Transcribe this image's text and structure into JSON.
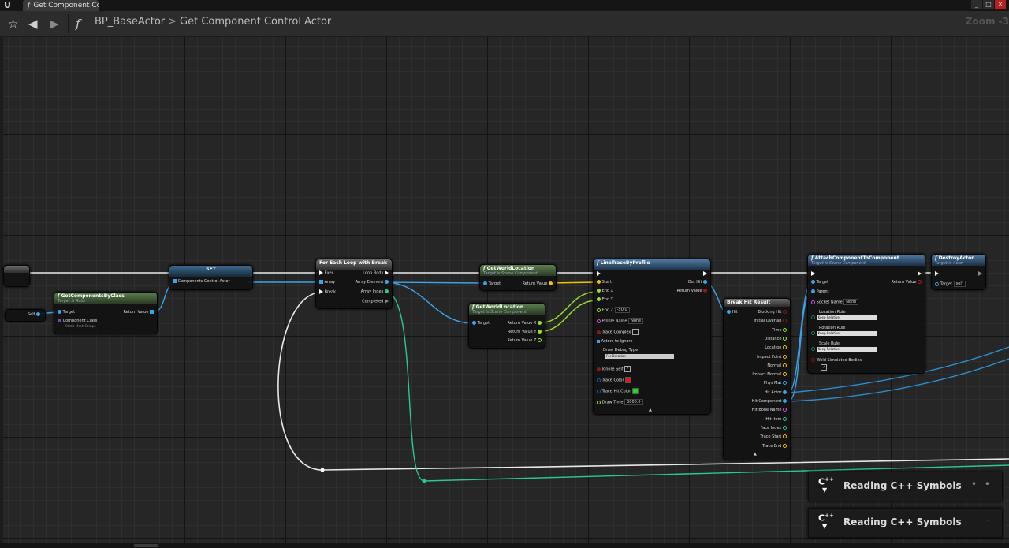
{
  "window": {
    "tab_title": "Get Component Cc",
    "tab_icon": "function-icon"
  },
  "toolbar": {
    "breadcrumb_root": "BP_BaseActor",
    "breadcrumb_separator": ">",
    "breadcrumb_current": "Get Component Control Actor",
    "zoom_label": "Zoom -3"
  },
  "nodes": {
    "get_components": {
      "title": "GetComponentsByClass",
      "subtitle": "Target is Actor",
      "target": "Target",
      "return_value": "Return Value",
      "component_class": "Component Class",
      "class_value": "Static Mesh Compo"
    },
    "self": {
      "label": "Self"
    },
    "set": {
      "title": "SET",
      "var": "Components Control Actor"
    },
    "foreach": {
      "title": "For Each Loop with Break",
      "exec": "Exec",
      "array": "Array",
      "break": "Break",
      "loop_body": "Loop Body",
      "array_element": "Array Element",
      "array_index": "Array Index",
      "completed": "Completed"
    },
    "getworld1": {
      "title": "GetWorldLocation",
      "subtitle": "Target is Scene Component",
      "target": "Target",
      "return_value": "Return Value"
    },
    "getworld2": {
      "title": "GetWorldLocation",
      "subtitle": "Target is Scene Component",
      "target": "Target",
      "rx": "Return Value X",
      "ry": "Return Value Y",
      "rz": "Return Value Z"
    },
    "linetrace": {
      "title": "LineTraceByProfile",
      "start": "Start",
      "end_x": "End X",
      "end_y": "End Y",
      "end_z": "End Z",
      "end_z_value": "-50.0",
      "profile_name": "Profile Name",
      "profile_value": "None",
      "trace_complex": "Trace Complex",
      "actors_to_ignore": "Actors to Ignore",
      "draw_debug_type": "Draw Debug Type",
      "draw_debug_value": "For Duration",
      "ignore_self": "Ignore Self",
      "trace_color": "Trace Color",
      "trace_hit_color": "Trace Hit Color",
      "draw_time": "Draw Time",
      "draw_time_value": "5000.0",
      "out_hit": "Out Hit",
      "return_value": "Return Value",
      "trace_color_hex": "#e01818",
      "trace_hit_color_hex": "#18e018"
    },
    "breakhit": {
      "title": "Break Hit Result",
      "hit": "Hit",
      "outputs": [
        "Blocking Hit",
        "Initial Overlap",
        "Time",
        "Distance",
        "Location",
        "Impact Point",
        "Normal",
        "Impact Normal",
        "Phys Mat",
        "Hit Actor",
        "Hit Component",
        "Hit Bone Name",
        "Hit Item",
        "Face Index",
        "Trace Start",
        "Trace End"
      ]
    },
    "attach": {
      "title": "AttachComponentToComponent",
      "subtitle": "Target is Scene Component",
      "target": "Target",
      "parent": "Parent",
      "socket_name": "Socket Name",
      "socket_value": "None",
      "location_rule": "Location Rule",
      "location_value": "Keep Relative",
      "rotation_rule": "Rotation Rule",
      "rotation_value": "Keep Relative",
      "scale_rule": "Scale Rule",
      "scale_value": "Keep Relative",
      "weld": "Weld Simulated Bodies",
      "return_value": "Return Value"
    },
    "destroy": {
      "title": "DestroyActor",
      "subtitle": "Target is Actor",
      "target": "Target",
      "target_value": "self"
    }
  },
  "notifications": [
    {
      "icon": "cpp-icon",
      "label": "Reading C++ Symbols"
    },
    {
      "icon": "cpp-icon",
      "label": "Reading C++ Symbols"
    }
  ]
}
